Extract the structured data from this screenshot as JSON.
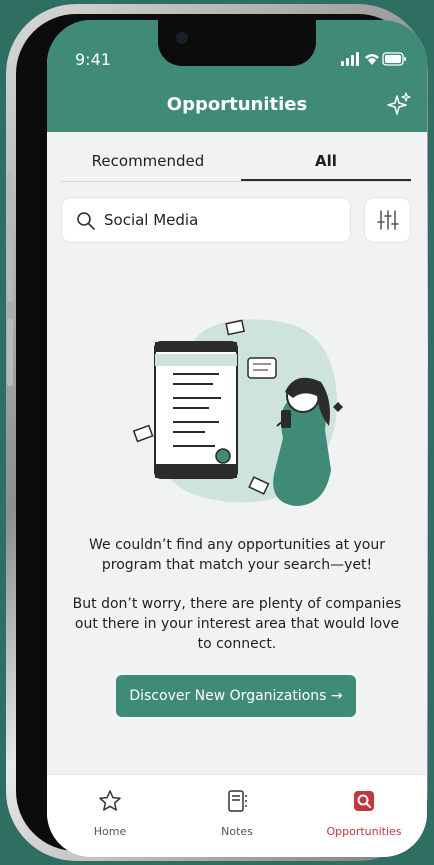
{
  "status_bar": {
    "time": "9:41"
  },
  "header": {
    "title": "Opportunities",
    "action_icon": "sparkle-icon"
  },
  "tabs": [
    {
      "label": "Recommended",
      "active": false
    },
    {
      "label": "All",
      "active": true
    }
  ],
  "search": {
    "value": "Social Media",
    "search_icon": "search-icon",
    "filter_icon": "sliders-icon"
  },
  "empty_state": {
    "illustration": "person-with-phone-illustration",
    "message_line1": "We couldn’t find any opportunities at your program that match your search—yet!",
    "message_line2": "But don’t worry, there are plenty of companies out there in your interest area that would love to connect.",
    "cta_label": "Discover New Organizations →"
  },
  "bottom_nav": [
    {
      "label": "Home",
      "icon": "star-icon",
      "active": false
    },
    {
      "label": "Notes",
      "icon": "notes-icon",
      "active": false
    },
    {
      "label": "Opportunities",
      "icon": "search-badge-icon",
      "active": true
    }
  ],
  "colors": {
    "brand_green": "#3f8b77",
    "active_red": "#c0383f",
    "background": "#f1f3f3"
  }
}
